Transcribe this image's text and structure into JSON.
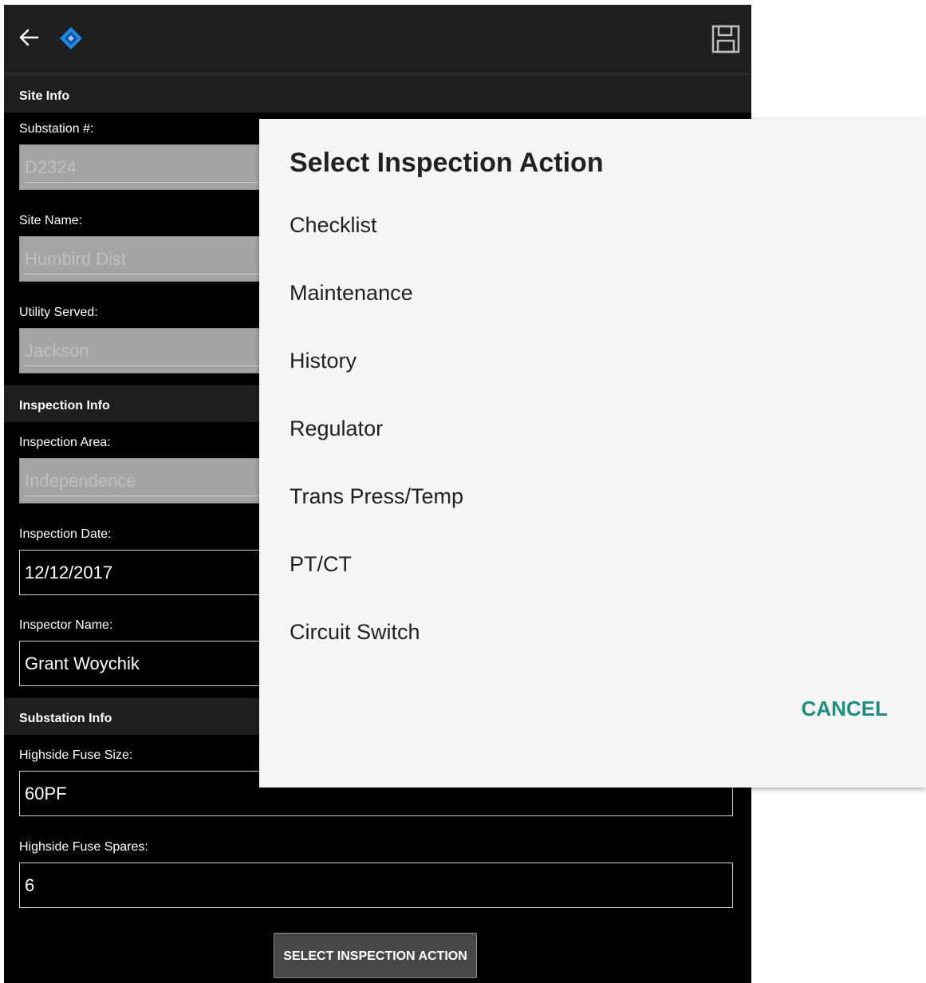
{
  "appbar": {
    "back_icon": "arrow-left-icon",
    "logo_icon": "diamond-logo-icon",
    "save_icon": "floppy-disk-icon",
    "accent": "#1e88e5"
  },
  "site_info": {
    "header": "Site Info",
    "substation_label": "Substation #:",
    "substation_value": "D2324",
    "site_name_label": "Site Name:",
    "site_name_value": "Humbird Dist",
    "utility_label": "Utility Served:",
    "utility_value": "Jackson"
  },
  "inspection_info": {
    "header": "Inspection Info",
    "area_label": "Inspection Area:",
    "area_value": "Independence",
    "date_label": "Inspection Date:",
    "date_value": "12/12/2017",
    "inspector_label": "Inspector Name:",
    "inspector_value": "Grant Woychik"
  },
  "substation_info": {
    "header": "Substation Info",
    "fuse_size_label": "Highside Fuse Size:",
    "fuse_size_value": "60PF",
    "fuse_spares_label": "Highside Fuse Spares:",
    "fuse_spares_value": "6"
  },
  "action_button": "SELECT INSPECTION ACTION",
  "dialog": {
    "title": "Select Inspection Action",
    "items": [
      "Checklist",
      "Maintenance",
      "History",
      "Regulator",
      "Trans Press/Temp",
      "PT/CT",
      "Circuit Switch"
    ],
    "cancel": "CANCEL",
    "accent": "#1a8f80"
  }
}
